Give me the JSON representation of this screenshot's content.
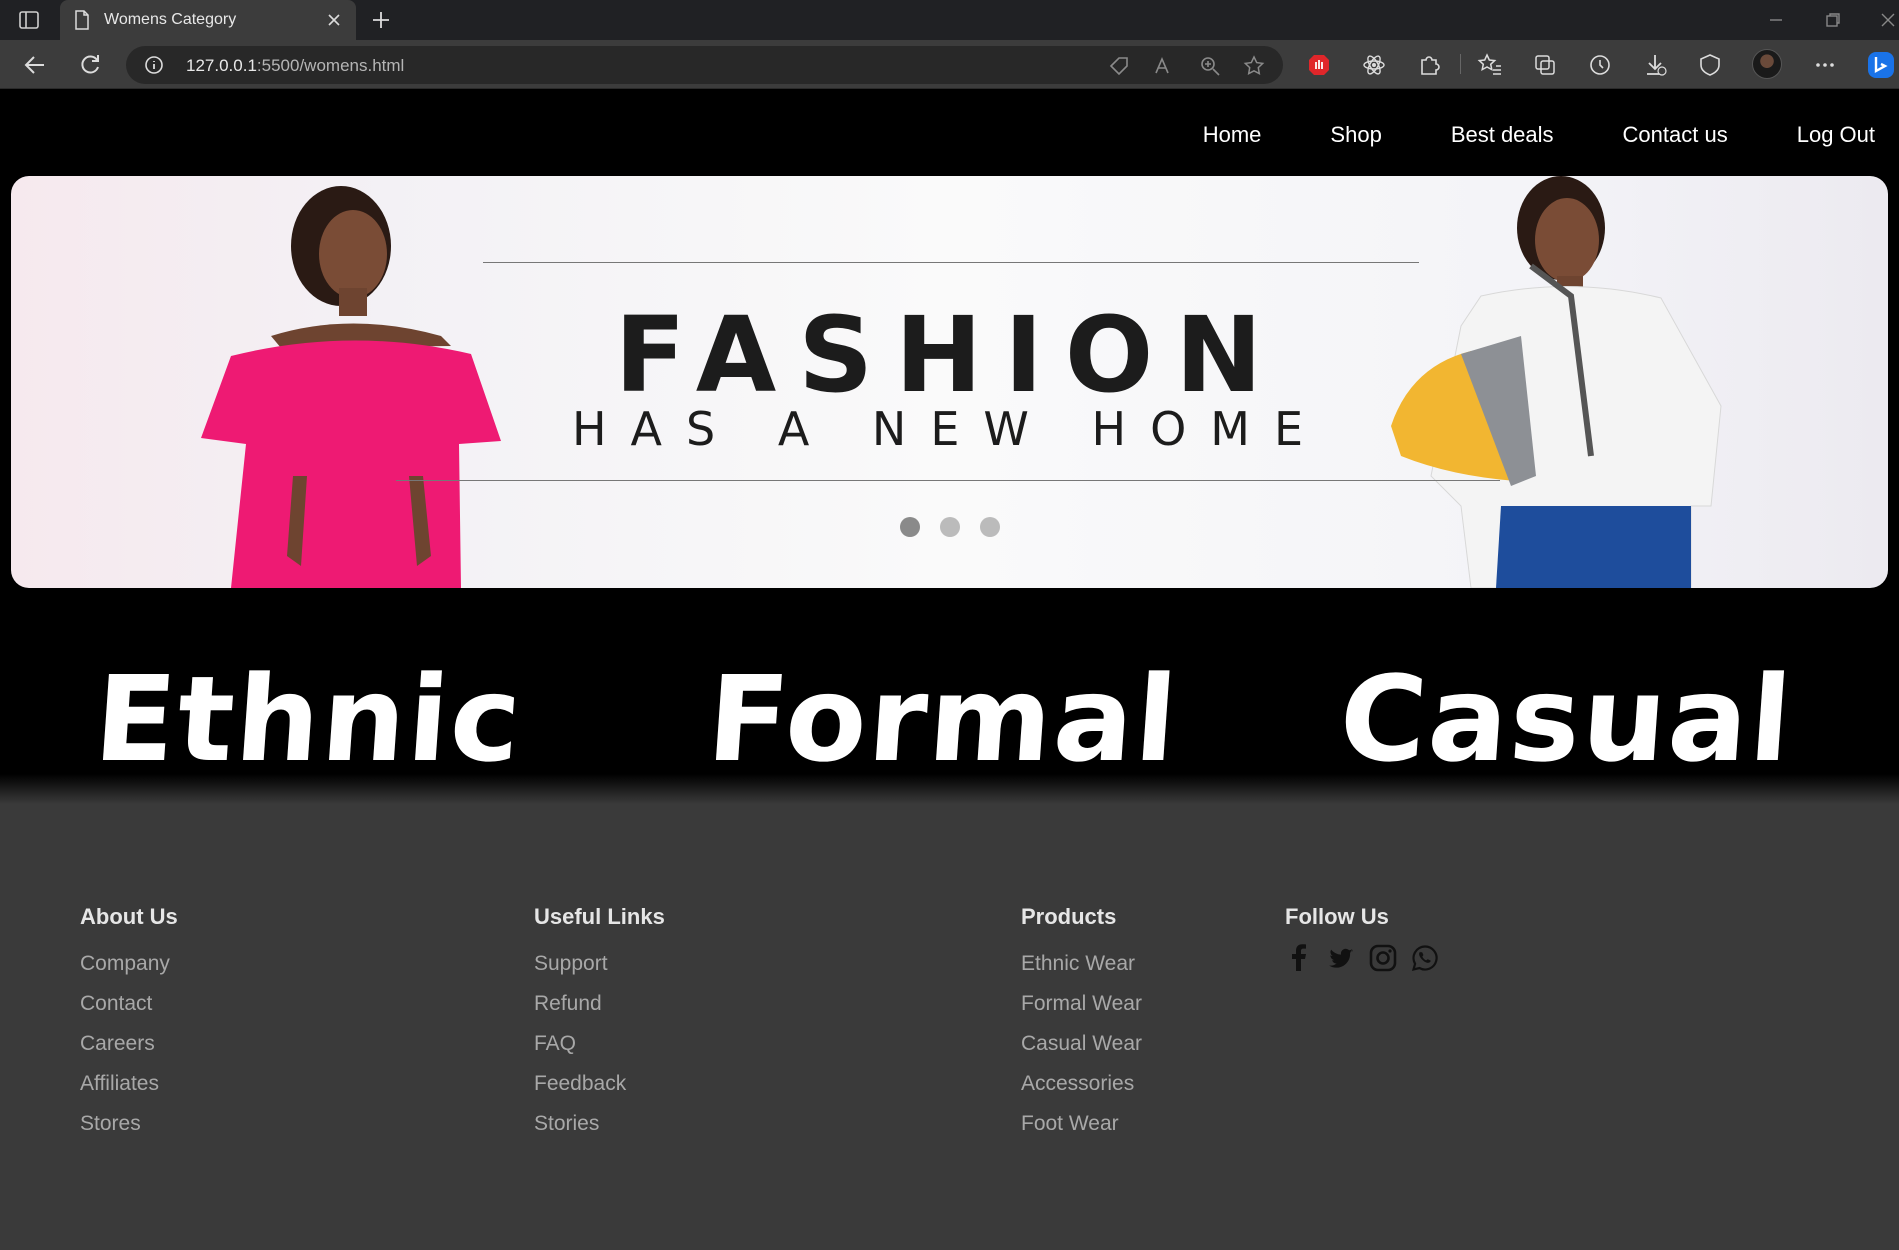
{
  "browser": {
    "tab_title": "Womens Category",
    "url_host": "127.0.0.1",
    "url_rest": ":5500/womens.html"
  },
  "nav": {
    "items": [
      "Home",
      "Shop",
      "Best deals",
      "Contact us",
      "Log Out"
    ]
  },
  "banner": {
    "headline": "FASHION",
    "subline": "HAS A NEW HOME",
    "slide_count": 3,
    "active_slide": 1
  },
  "categories": [
    "Ethnic",
    "Formal",
    "Casual"
  ],
  "footer": {
    "about": {
      "heading": "About Us",
      "links": [
        "Company",
        "Contact",
        "Careers",
        "Affiliates",
        "Stores"
      ]
    },
    "useful": {
      "heading": "Useful Links",
      "links": [
        "Support",
        "Refund",
        "FAQ",
        "Feedback",
        "Stories"
      ]
    },
    "products": {
      "heading": "Products",
      "links": [
        "Ethnic Wear",
        "Formal Wear",
        "Casual Wear",
        "Accessories",
        "Foot Wear"
      ]
    },
    "follow": {
      "heading": "Follow Us",
      "icons": [
        "facebook-icon",
        "twitter-icon",
        "instagram-icon",
        "whatsapp-icon"
      ]
    }
  },
  "colors": {
    "page_bg": "#000000",
    "footer_bg": "#3a3a3a",
    "browser_chrome": "#3c3c3c",
    "dress_pink": "#ee1a73"
  }
}
